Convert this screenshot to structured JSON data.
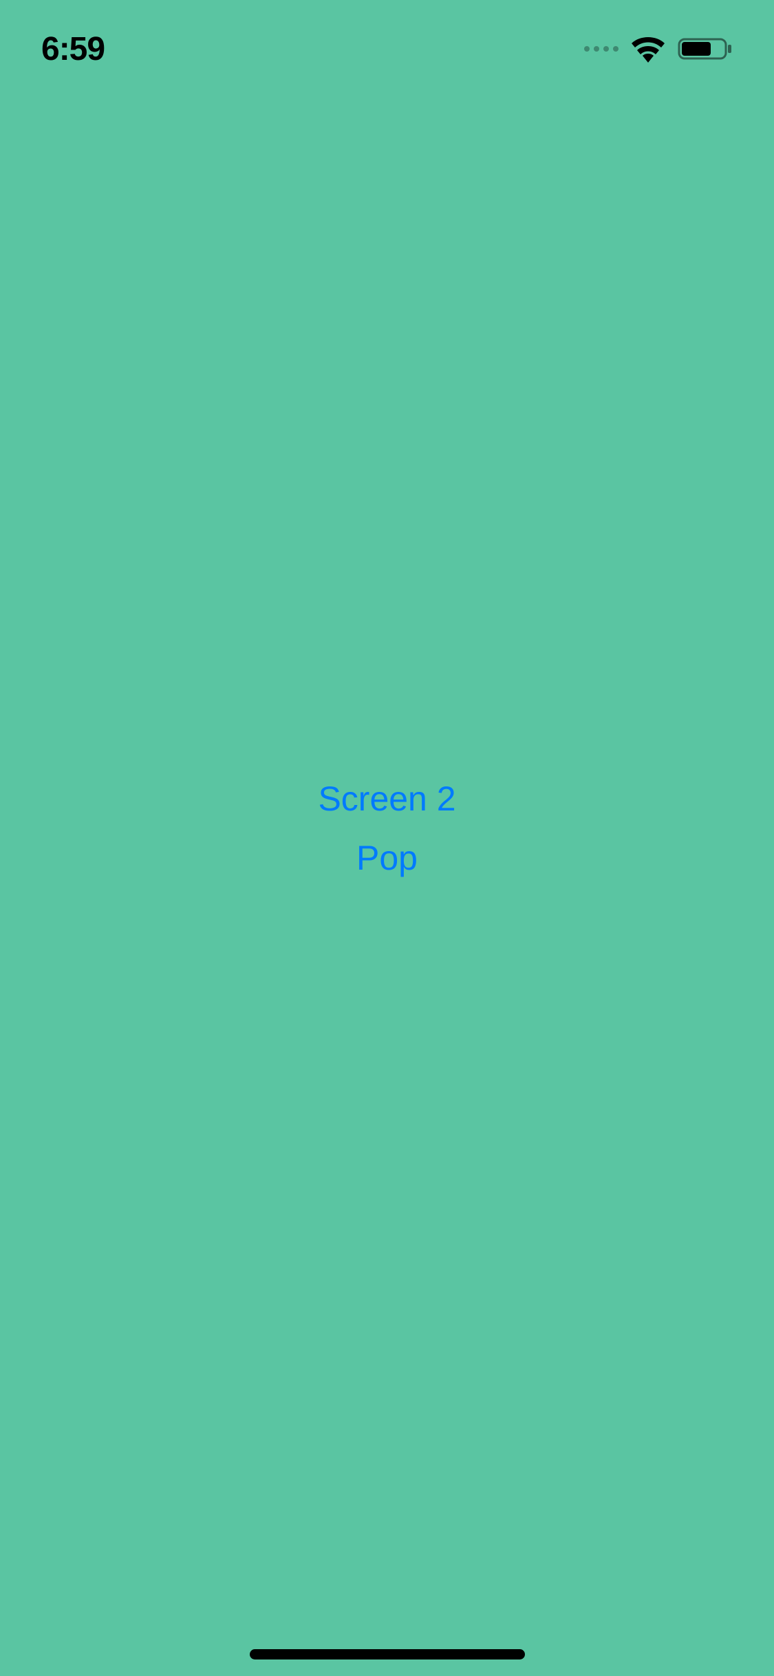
{
  "status_bar": {
    "time": "6:59"
  },
  "content": {
    "screen_button_label": "Screen 2",
    "pop_button_label": "Pop"
  }
}
